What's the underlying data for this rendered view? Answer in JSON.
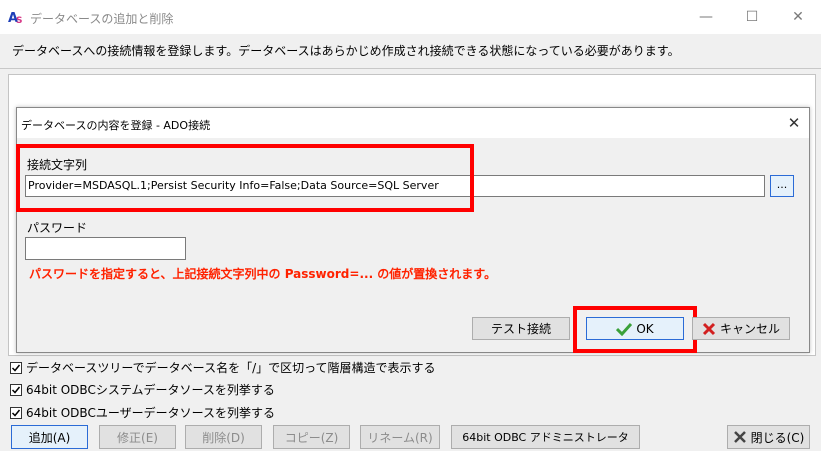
{
  "window": {
    "title": "データベースの追加と削除",
    "minimize": "—",
    "maximize": "☐",
    "close": "✕"
  },
  "description": "データベースへの接続情報を登録します。データベースはあらかじめ作成され接続できる状態になっている必要があります。",
  "dialog": {
    "title": "データベースの内容を登録 - ADO接続",
    "close": "✕",
    "conn_label": "接続文字列",
    "conn_value": "Provider=MSDASQL.1;Persist Security Info=False;Data Source=SQL Server",
    "browse": "...",
    "pw_label": "パスワード",
    "pw_value": "",
    "warning": "パスワードを指定すると、上記接続文字列中の Password=... の値が置換されます。",
    "test_button": "テスト接続",
    "ok_button": "OK",
    "cancel_button": "キャンセル"
  },
  "options": [
    {
      "label": "データベースツリーでデータベース名を「/」で区切って階層構造で表示する",
      "checked": true
    },
    {
      "label": "64bit ODBCシステムデータソースを列挙する",
      "checked": true
    },
    {
      "label": "64bit ODBCユーザーデータソースを列挙する",
      "checked": true
    }
  ],
  "buttons": {
    "add": "追加(A)",
    "edit": "修正(E)",
    "delete": "削除(D)",
    "copy": "コピー(Z)",
    "rename": "リネーム(R)",
    "odbc_admin": "64bit ODBC アドミニストレータ",
    "close": "閉じる(C)"
  },
  "colors": {
    "warning": "#ff2200",
    "highlight": "#ff0000",
    "ok_check": "#3aa13a",
    "cancel_x": "#d21f1f"
  }
}
